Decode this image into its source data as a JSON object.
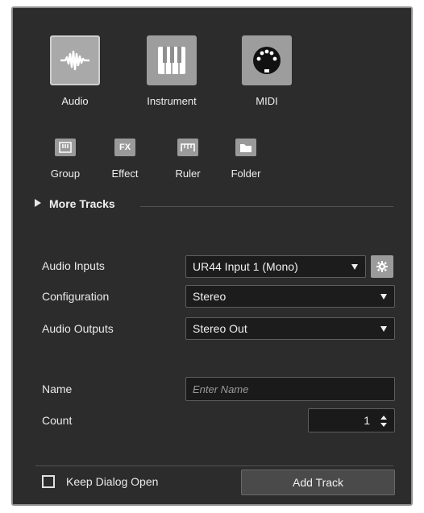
{
  "track_types": [
    {
      "label": "Audio",
      "icon": "audio-waveform-icon",
      "selected": true
    },
    {
      "label": "Instrument",
      "icon": "piano-keys-icon",
      "selected": false
    },
    {
      "label": "MIDI",
      "icon": "midi-plug-icon",
      "selected": false
    }
  ],
  "small_types": [
    {
      "label": "Group",
      "icon": "group-icon"
    },
    {
      "label": "Effect",
      "icon": "fx-icon",
      "glyph": "FX"
    },
    {
      "label": "Ruler",
      "icon": "ruler-icon"
    },
    {
      "label": "Folder",
      "icon": "folder-icon"
    }
  ],
  "more_tracks": "More Tracks",
  "fields": {
    "audio_inputs": {
      "label": "Audio Inputs",
      "value": "UR44 Input 1 (Mono)"
    },
    "configuration": {
      "label": "Configuration",
      "value": "Stereo"
    },
    "audio_outputs": {
      "label": "Audio Outputs",
      "value": "Stereo Out"
    },
    "name": {
      "label": "Name",
      "placeholder": "Enter Name",
      "value": ""
    },
    "count": {
      "label": "Count",
      "value": "1"
    }
  },
  "footer": {
    "keep_open_label": "Keep Dialog Open",
    "keep_open_checked": false,
    "add_button": "Add Track"
  },
  "colors": {
    "dialog_bg": "#2c2c2c",
    "tile": "#9d9d9d",
    "field_bg": "#1c1c1c"
  }
}
